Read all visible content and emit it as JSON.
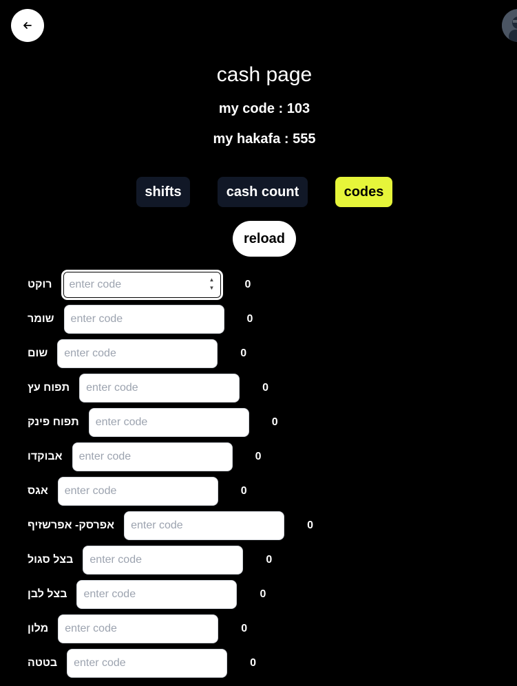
{
  "header": {
    "back_icon": "arrow-left-icon",
    "avatar": "user-avatar"
  },
  "page": {
    "title": "cash page",
    "my_code": "my code : 103",
    "my_hakafa": "my hakafa : 555"
  },
  "tabs": [
    {
      "label": "shifts",
      "active": false
    },
    {
      "label": "cash count",
      "active": false
    },
    {
      "label": "codes",
      "active": true
    }
  ],
  "colors": {
    "background": "#000000",
    "tab_bg": "#111827",
    "tab_active_bg": "#e6f53a",
    "button_bg": "#ffffff"
  },
  "reload_label": "reload",
  "input_placeholder": "enter code",
  "rows": [
    {
      "label": "רוקט",
      "value": "0"
    },
    {
      "label": "שומר",
      "value": "0"
    },
    {
      "label": "שום",
      "value": "0"
    },
    {
      "label": "תפוח עץ",
      "value": "0"
    },
    {
      "label": "תפוח פינק",
      "value": "0"
    },
    {
      "label": "אבוקדו",
      "value": "0"
    },
    {
      "label": "אגס",
      "value": "0"
    },
    {
      "label": "אפרסק- אפרשזיף",
      "value": "0"
    },
    {
      "label": "בצל סגול",
      "value": "0"
    },
    {
      "label": "בצל לבן",
      "value": "0"
    },
    {
      "label": "מלון",
      "value": "0"
    },
    {
      "label": "בטטה",
      "value": "0"
    }
  ]
}
